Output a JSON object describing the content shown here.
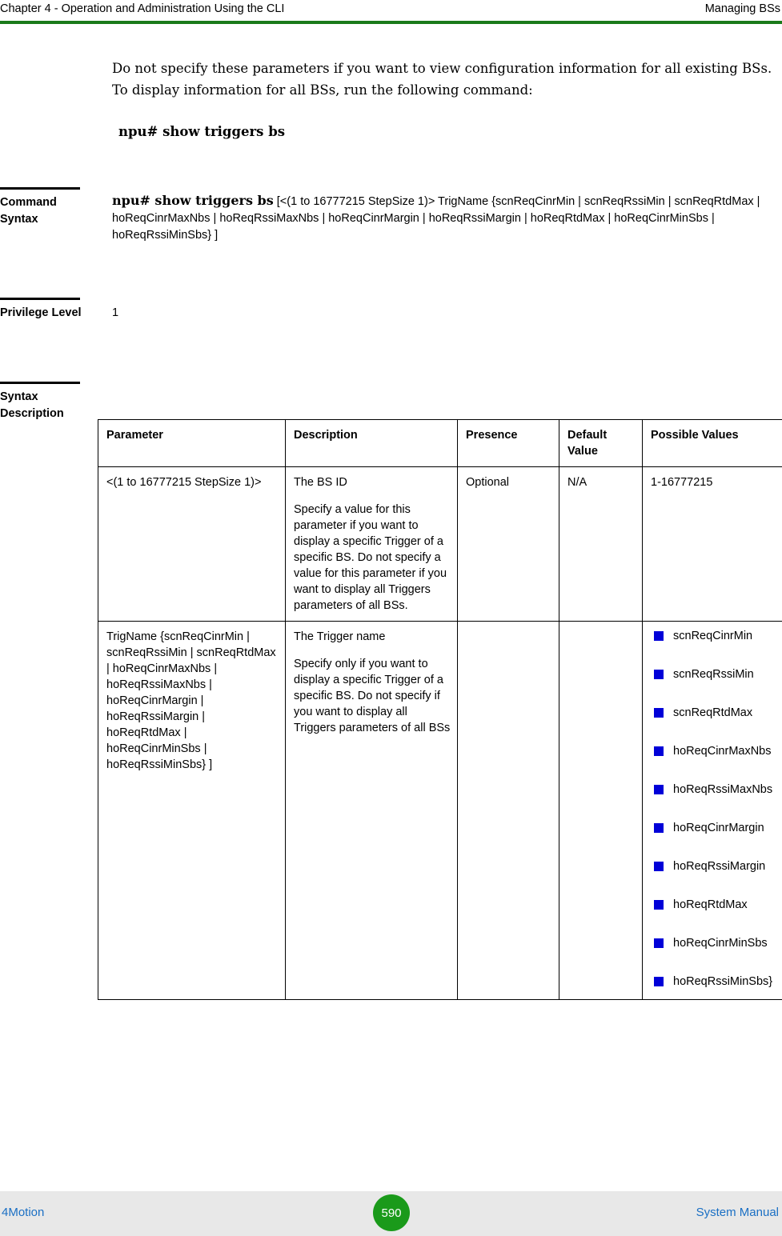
{
  "header": {
    "left": "Chapter 4 - Operation and Administration Using the CLI",
    "right": "Managing BSs"
  },
  "intro": {
    "paragraph": "Do not specify these parameters if you want to view configuration information for all existing BSs. To display information for all BSs, run the following command:",
    "command": "npu# show triggers bs"
  },
  "sections": {
    "command_syntax_label": "Command Syntax",
    "command_syntax_bold": "npu# show triggers bs",
    "command_syntax_rest": " [<(1 to 16777215 StepSize 1)> TrigName {scnReqCinrMin | scnReqRssiMin | scnReqRtdMax | hoReqCinrMaxNbs | hoReqRssiMaxNbs | hoReqCinrMargin | hoReqRssiMargin | hoReqRtdMax | hoReqCinrMinSbs | hoReqRssiMinSbs} ]",
    "privilege_level_label": "Privilege Level",
    "privilege_level_value": "1",
    "syntax_description_label": "Syntax Description"
  },
  "table": {
    "headers": [
      "Parameter",
      "Description",
      "Presence",
      "Default Value",
      "Possible Values"
    ],
    "rows": [
      {
        "parameter": "<(1 to 16777215 StepSize 1)>",
        "description_1": "The BS ID",
        "description_2": "Specify a value for this parameter if you want to display a specific Trigger of a specific BS. Do not specify a value for this parameter if you want to display all Triggers parameters of all BSs.",
        "presence": "Optional",
        "default_value": "N/A",
        "possible_values": "1-16777215"
      },
      {
        "parameter": "TrigName {scnReqCinrMin | scnReqRssiMin | scnReqRtdMax | hoReqCinrMaxNbs | hoReqRssiMaxNbs | hoReqCinrMargin | hoReqRssiMargin | hoReqRtdMax | hoReqCinrMinSbs | hoReqRssiMinSbs} ]",
        "description_1": "The Trigger name",
        "description_2": "Specify only if you want to display a specific Trigger of a specific BS. Do not specify if you want to display all Triggers parameters of all BSs",
        "presence": "",
        "default_value": "",
        "possible_values_list": [
          "scnReqCinrMin",
          "scnReqRssiMin",
          "scnReqRtdMax",
          "hoReqCinrMaxNbs",
          "hoReqRssiMaxNbs",
          "hoReqCinrMargin",
          "hoReqRssiMargin",
          "hoReqRtdMax",
          "hoReqCinrMinSbs",
          "hoReqRssiMinSbs}"
        ]
      }
    ]
  },
  "footer": {
    "left": "4Motion",
    "page": "590",
    "right": "System Manual"
  },
  "colors": {
    "header_rule": "#1a7a1a",
    "bullet": "#0000d8",
    "footer_link": "#1a6fc4",
    "footer_badge": "#1a9a1a"
  }
}
